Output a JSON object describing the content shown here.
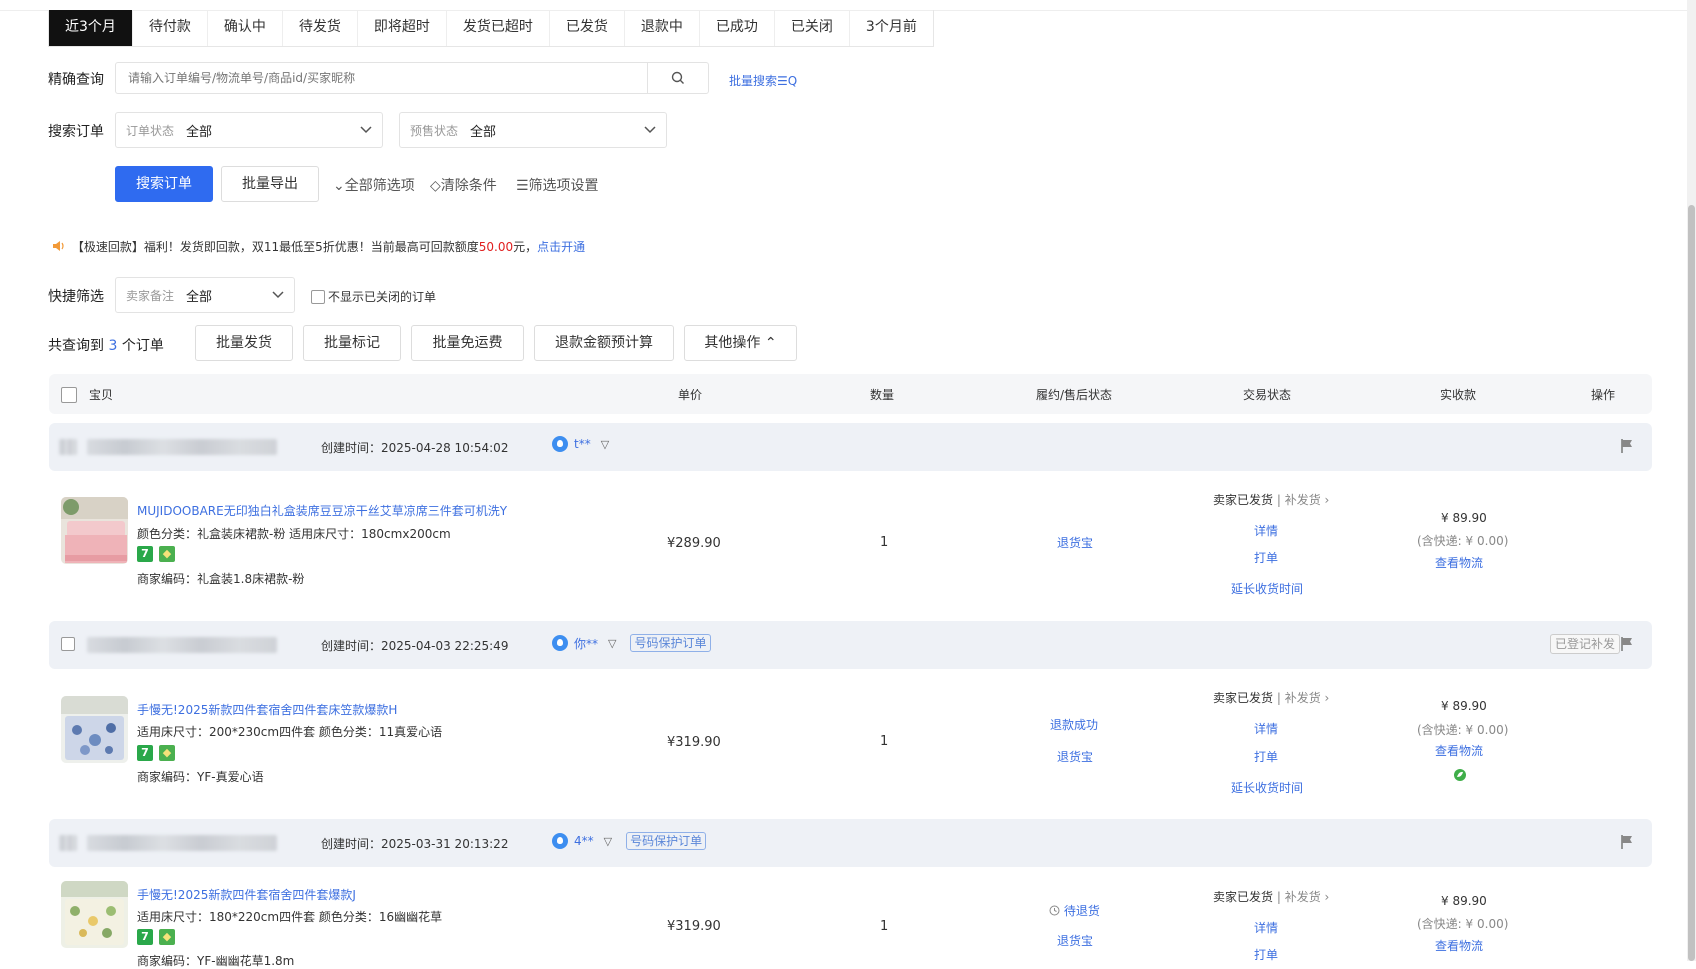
{
  "tabs": [
    "近3个月",
    "待付款",
    "确认中",
    "待发货",
    "即将超时",
    "发货已超时",
    "已发货",
    "退款中",
    "已成功",
    "已关闭",
    "3个月前"
  ],
  "search": {
    "label": "精确查询",
    "placeholder": "请输入订单编号/物流单号/商品id/买家昵称",
    "batch_link": "批量搜索☰Q"
  },
  "filter": {
    "label": "搜索订单",
    "order_status_label": "订单状态",
    "order_status_value": "全部",
    "presale_label": "预售状态",
    "presale_value": "全部"
  },
  "actions": {
    "search_btn": "搜索订单",
    "export_btn": "批量导出",
    "all_filters": "⌄全部筛选项",
    "clear": "◇清除条件",
    "settings": "☰筛选项设置"
  },
  "notice": {
    "text": "【极速回款】福利！发货即回款，双11最低至5折优惠！当前最高可回款额度",
    "amount": "50.00",
    "unit": "元，",
    "link": "点击开通"
  },
  "quick": {
    "label": "快捷筛选",
    "remark_label": "卖家备注",
    "remark_value": "全部",
    "hide_closed": "不显示已关闭的订单"
  },
  "summary": {
    "prefix": "共查询到",
    "count": "3",
    "suffix": "个订单",
    "buttons": [
      "批量发货",
      "批量标记",
      "批量免运费",
      "退款金额预计算",
      "其他操作 ⌃"
    ]
  },
  "columns": [
    "宝贝",
    "单价",
    "数量",
    "履约/售后状态",
    "交易状态",
    "实收款",
    "操作"
  ],
  "orders": [
    {
      "created": "创建时间：2025-04-28 10:54:02",
      "buyer": "t**",
      "protected": "",
      "registered": "",
      "title": "MUJIDOOBARE无印独白礼盒装席豆豆凉干丝艾草凉席三件套可机洗Y",
      "spec": "颜色分类：礼盒装床裙款-粉   适用床尺寸：180cmx200cm",
      "code": "商家编码：礼盒装1.8床裙款-粉",
      "price": "¥289.90",
      "qty": "1",
      "after": [
        "退货宝"
      ],
      "after_pending": "",
      "status": "卖家已发货",
      "reship": "补发货",
      "status_links": [
        "详情",
        "打单",
        "延长收货时间"
      ],
      "paid": "¥ 89.90",
      "shipping": "(含快递: ¥ 0.00)",
      "logistics": "查看物流"
    },
    {
      "created": "创建时间：2025-04-03 22:25:49",
      "buyer": "你**",
      "protected": "号码保护订单",
      "registered": "已登记补发",
      "title": "手慢无!2025新款四件套宿舍四件套床笠款爆款H",
      "spec": "适用床尺寸：200*230cm四件套   颜色分类：11真爱心语",
      "code": "商家编码：YF-真爱心语",
      "price": "¥319.90",
      "qty": "1",
      "after": [
        "退款成功",
        "退货宝"
      ],
      "after_pending": "",
      "status": "卖家已发货",
      "reship": "补发货",
      "status_links": [
        "详情",
        "打单",
        "延长收货时间"
      ],
      "paid": "¥ 89.90",
      "shipping": "(含快递: ¥ 0.00)",
      "logistics": "查看物流"
    },
    {
      "created": "创建时间：2025-03-31 20:13:22",
      "buyer": "4**",
      "protected": "号码保护订单",
      "registered": "",
      "title": "手慢无!2025新款四件套宿舍四件套爆款J",
      "spec": "适用床尺寸：180*220cm四件套   颜色分类：16幽幽花草",
      "code": "商家编码：YF-幽幽花草1.8m",
      "price": "¥319.90",
      "qty": "1",
      "after": [
        "退货宝"
      ],
      "after_pending": "待退货",
      "status": "卖家已发货",
      "reship": "补发货",
      "status_links": [
        "详情",
        "打单"
      ],
      "paid": "¥ 89.90",
      "shipping": "(含快递: ¥ 0.00)",
      "logistics": "查看物流"
    }
  ]
}
